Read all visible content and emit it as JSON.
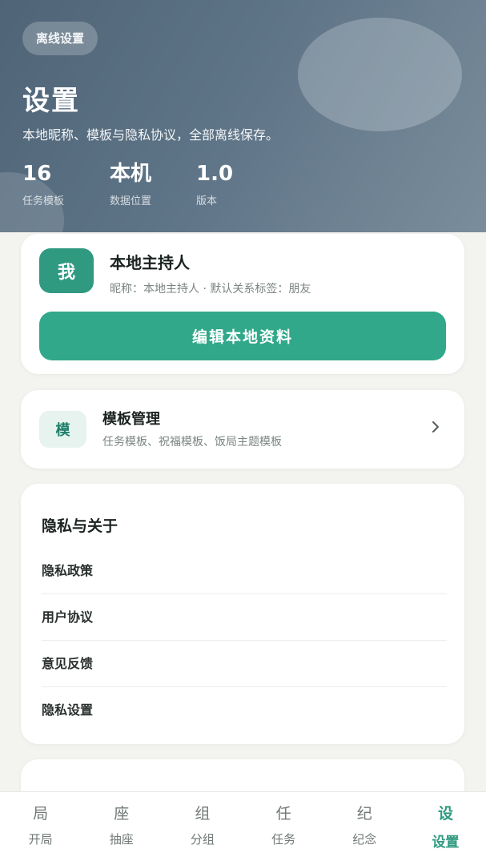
{
  "header": {
    "chip": "离线设置",
    "title": "设置",
    "subtitle": "本地昵称、模板与隐私协议，全部离线保存。",
    "stats": [
      {
        "value": "16",
        "label": "任务模板"
      },
      {
        "value": "本机",
        "label": "数据位置"
      },
      {
        "value": "1.0",
        "label": "版本"
      }
    ]
  },
  "profile": {
    "avatar_text": "我",
    "name": "本地主持人",
    "meta": "昵称：本地主持人 · 默认关系标签：朋友",
    "edit_button": "编辑本地资料"
  },
  "templates": {
    "icon_text": "模",
    "title": "模板管理",
    "desc": "任务模板、祝福模板、饭局主题模板",
    "chevron": "chevron-right-icon"
  },
  "privacy": {
    "title": "隐私与关于",
    "items": [
      "隐私政策",
      "用户协议",
      "意见反馈",
      "隐私设置"
    ]
  },
  "next_section": {
    "title": ""
  },
  "tabbar": {
    "tabs": [
      {
        "glyph": "局",
        "label": "开局"
      },
      {
        "glyph": "座",
        "label": "抽座"
      },
      {
        "glyph": "组",
        "label": "分组"
      },
      {
        "glyph": "任",
        "label": "任务"
      },
      {
        "glyph": "纪",
        "label": "纪念"
      },
      {
        "glyph": "设",
        "label": "设置"
      }
    ],
    "active_index": 5
  },
  "colors": {
    "accent": "#30a889",
    "header_bg": "#5d7386",
    "page_bg": "#f3f3ef"
  }
}
